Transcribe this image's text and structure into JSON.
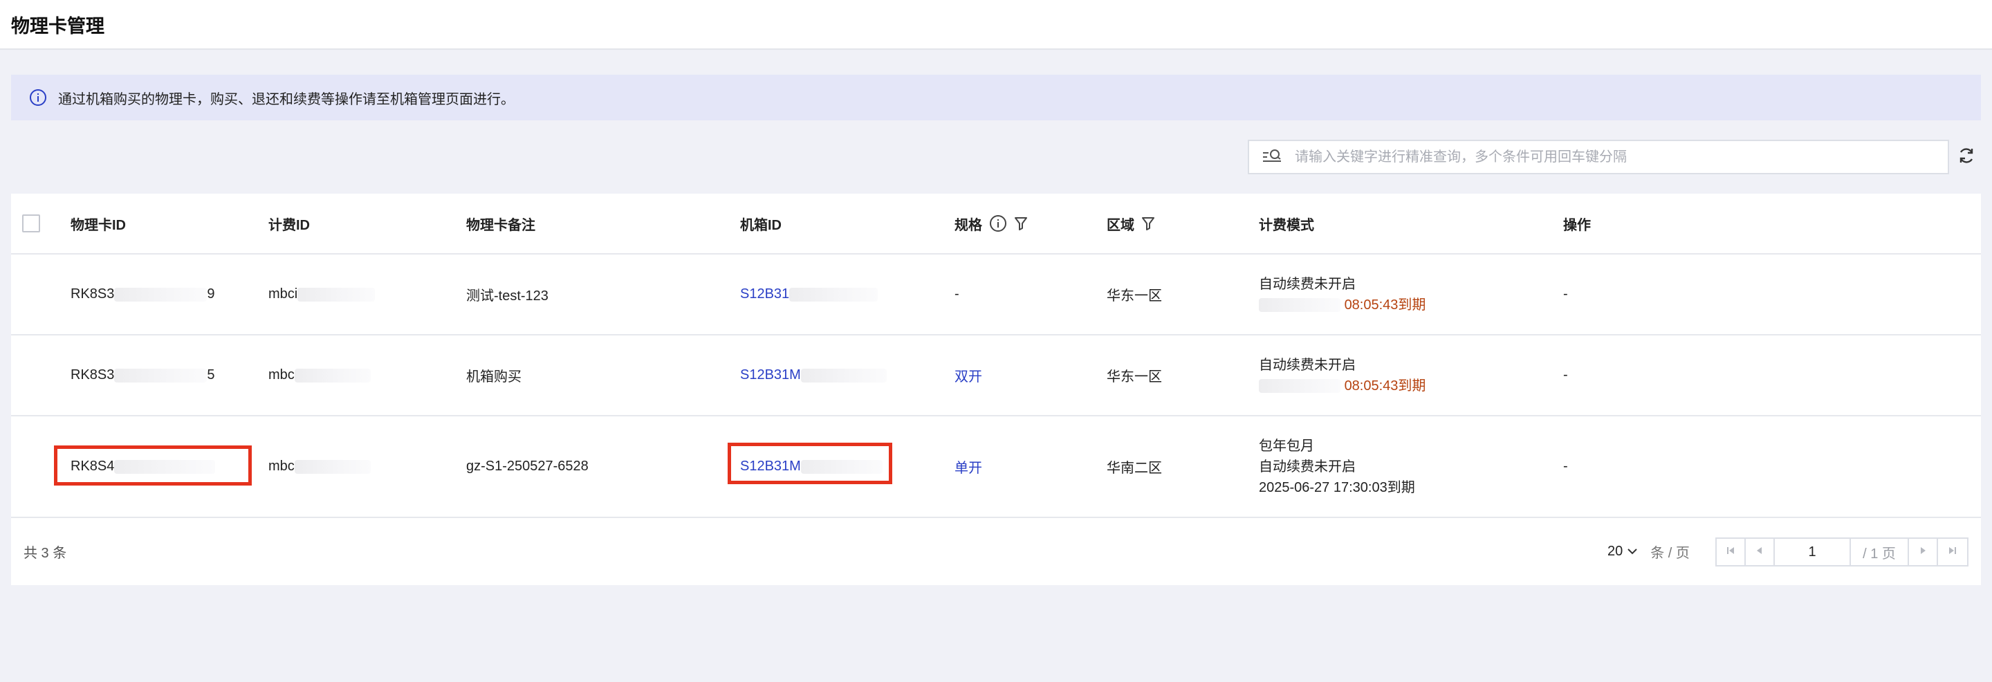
{
  "page": {
    "title": "物理卡管理"
  },
  "notice": {
    "text": "通过机箱购买的物理卡，购买、退还和续费等操作请至机箱管理页面进行。"
  },
  "search": {
    "placeholder": "请输入关键字进行精准查询，多个条件可用回车键分隔"
  },
  "table": {
    "columns": {
      "id": "物理卡ID",
      "bill": "计费ID",
      "note": "物理卡备注",
      "box": "机箱ID",
      "spec": "规格",
      "region": "区域",
      "mode": "计费模式",
      "op": "操作"
    },
    "rows": [
      {
        "id": "RK8S3",
        "id_tail": "9",
        "bill": "mbci",
        "note": "测试-test-123",
        "box": "S12B31",
        "spec": "-",
        "region": "华东一区",
        "mode_line1": "自动续费未开启",
        "mode_line2": "08:05:43到期",
        "op": "-"
      },
      {
        "id": "RK8S3",
        "id_tail": "5",
        "bill": "mbc",
        "note": "机箱购买",
        "box": "S12B31M",
        "spec": "双开",
        "region": "华东一区",
        "mode_line1": "自动续费未开启",
        "mode_line2": "08:05:43到期",
        "op": "-"
      },
      {
        "id": "RK8S4",
        "bill": "mbc",
        "note": "gz-S1-250527-6528",
        "box": "S12B31M",
        "spec": "单开",
        "region": "华南二区",
        "mode_line0": "包年包月",
        "mode_line1": "自动续费未开启",
        "mode_line2": "2025-06-27 17:30:03到期",
        "op": "-"
      }
    ]
  },
  "footer": {
    "total": "共 3 条",
    "page_size": "20",
    "page_size_unit": "条 / 页",
    "current_page": "1",
    "total_pages": "/ 1 页"
  },
  "colors": {
    "link": "#2a3fc6",
    "expire": "#b64310",
    "highlight": "#e5321d"
  }
}
